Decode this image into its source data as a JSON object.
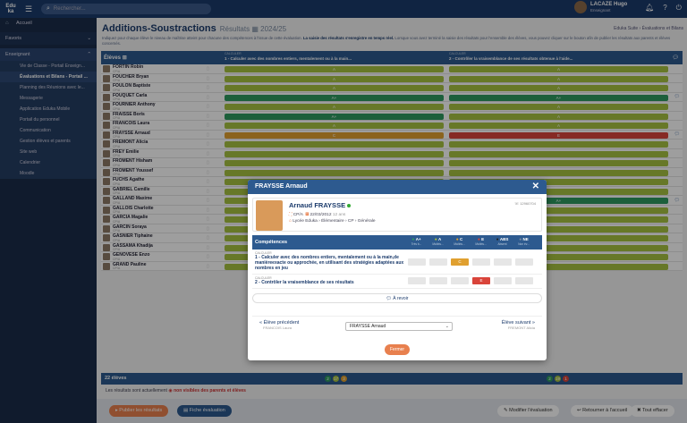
{
  "app": {
    "logo_line1": "Edu",
    "logo_line2": "ka",
    "search_placeholder": "Rechercher..."
  },
  "user": {
    "name": "LACAZE Hugo",
    "role": "Enseignant"
  },
  "sidebar": {
    "top": [
      {
        "label": "Accueil",
        "icon": "home-icon"
      }
    ],
    "favoris": "Favoris",
    "enseignant": "Enseignant",
    "sub": [
      {
        "label": "Vie de Classe - Portail Enseign...",
        "active": false
      },
      {
        "label": "Évaluations et Bilans - Portail ...",
        "active": true
      },
      {
        "label": "Planning des Réunions avec le...",
        "active": false
      },
      {
        "label": "Messagerie",
        "active": false
      },
      {
        "label": "Application Eduka Mobile",
        "active": false
      },
      {
        "label": "Portail du personnel",
        "active": false
      },
      {
        "label": "Communication",
        "active": false
      },
      {
        "label": "Gestion élèves et parents",
        "active": false
      },
      {
        "label": "Site web",
        "active": false
      },
      {
        "label": "Calendrier",
        "active": false
      },
      {
        "label": "Moodle",
        "active": false
      }
    ]
  },
  "page": {
    "title": "Additions-Soustractions",
    "subtitle": "Résultats",
    "year": "2024/25",
    "breadcrumb": "Eduka Suite › Évaluations et Bilans",
    "description_1": "Indiquez pour chaque élève le niveau de maîtrise atteint pour chacune des compétences à l'issue de cette évaluation. ",
    "description_bold": "La saisie des résultats s'enregistre en temps réel.",
    "description_2": " Lorsque vous avez terminé la saisie des résultats pour l'ensemble des élèves, vous pouvez cliquer sur le bouton afin de publier les résultats aux parents et élèves concernés."
  },
  "table": {
    "students_header": "Élèves",
    "c1_label": "CALCULER",
    "c1_text": "1 - Calculer avec des nombres entiers, mentalement ou à la main...",
    "c2_label": "CALCULER",
    "c2_text": "2 - Contrôler la vraisemblance de ses résultats obtenue à l'aide...",
    "rows": [
      {
        "name": "FORTIN Robin",
        "class": "CP/A",
        "r1": "A",
        "r2": "A",
        "c1": "#a7c242",
        "c2": "#a7c242"
      },
      {
        "name": "FOUCHER Bryan",
        "class": "CP/A",
        "r1": "A",
        "r2": "A",
        "c1": "#a7c242",
        "c2": "#a7c242"
      },
      {
        "name": "FOULON Baptiste",
        "class": "CP/A",
        "r1": "A",
        "r2": "A",
        "c1": "#a7c242",
        "c2": "#a7c242"
      },
      {
        "name": "FOUQUET Carla",
        "class": "CP/A",
        "r1": "A+",
        "r2": "A+",
        "c1": "#2e9a60",
        "c2": "#2e9a60"
      },
      {
        "name": "FOURNIER Anthony",
        "class": "CP/A",
        "r1": "A",
        "r2": "A",
        "c1": "#a7c242",
        "c2": "#a7c242"
      },
      {
        "name": "FRAISSE Boris",
        "class": "CP/A",
        "r1": "A+",
        "r2": "A",
        "c1": "#2e9a60",
        "c2": "#a7c242"
      },
      {
        "name": "FRANCOIS Laura",
        "class": "CP/A",
        "r1": "A",
        "r2": "A",
        "c1": "#a7c242",
        "c2": "#a7c242"
      },
      {
        "name": "FRAYSSE Arnaud",
        "class": "CP/A",
        "r1": "C",
        "r2": "E",
        "c1": "#e0a030",
        "c2": "#d9443a"
      },
      {
        "name": "FREMONT Alicia",
        "class": "CP/A",
        "r1": "",
        "r2": "",
        "c1": "#a7c242",
        "c2": "#a7c242"
      },
      {
        "name": "FREY Emilie",
        "class": "CP/A",
        "r1": "",
        "r2": "",
        "c1": "#a7c242",
        "c2": "#a7c242"
      },
      {
        "name": "FROMENT Hisham",
        "class": "CP/A",
        "r1": "",
        "r2": "",
        "c1": "#a7c242",
        "c2": "#a7c242"
      },
      {
        "name": "FROMENT Youssef",
        "class": "CP/A",
        "r1": "",
        "r2": "",
        "c1": "#a7c242",
        "c2": "#a7c242"
      },
      {
        "name": "FUCHS Agathe",
        "class": "CP/A",
        "r1": "",
        "r2": "",
        "c1": "#a7c242",
        "c2": "#a7c242"
      },
      {
        "name": "GABRIEL Camille",
        "class": "CP/A",
        "r1": "",
        "r2": "",
        "c1": "#a7c242",
        "c2": "#a7c242"
      },
      {
        "name": "GALLAND Maxime",
        "class": "CP/A",
        "r1": "",
        "r2": "A+",
        "c1": "#a7c242",
        "c2": "#2e9a60"
      },
      {
        "name": "GALLOIS Charlotte",
        "class": "CP/A",
        "r1": "",
        "r2": "",
        "c1": "#a7c242",
        "c2": "#a7c242"
      },
      {
        "name": "GARCIA Magalie",
        "class": "CP/A",
        "r1": "",
        "r2": "",
        "c1": "#a7c242",
        "c2": "#a7c242"
      },
      {
        "name": "GARCIN Soraya",
        "class": "CP/A",
        "r1": "",
        "r2": "",
        "c1": "#a7c242",
        "c2": "#a7c242"
      },
      {
        "name": "GASNIER Tiphaine",
        "class": "CP/A",
        "r1": "",
        "r2": "",
        "c1": "#a7c242",
        "c2": "#a7c242"
      },
      {
        "name": "GASSAMA Khadija",
        "class": "CP/A",
        "r1": "",
        "r2": "",
        "c1": "#a7c242",
        "c2": "#a7c242"
      },
      {
        "name": "GENOVESE Enzo",
        "class": "CP/A",
        "r1": "",
        "r2": "",
        "c1": "#a7c242",
        "c2": "#a7c242"
      },
      {
        "name": "GRAND Pauline",
        "class": "CP/A",
        "r1": "",
        "r2": "",
        "c1": "#a7c242",
        "c2": "#a7c242"
      }
    ],
    "footer_count": "22 élèves",
    "footer_pills_1": [
      {
        "v": "2",
        "color": "#2e9a60"
      },
      {
        "v": "17",
        "color": "#a7c242"
      },
      {
        "v": "3",
        "color": "#e0a030"
      }
    ],
    "footer_pills_2": [
      {
        "v": "2",
        "color": "#2e9a60"
      },
      {
        "v": "19",
        "color": "#a7c242"
      },
      {
        "v": "1",
        "color": "#d9443a"
      }
    ]
  },
  "note": {
    "prefix": "Les résultats sont actuellement",
    "red": "non visibles des parents et élèves"
  },
  "buttons": {
    "publish": "Publier les résultats",
    "fiche": "Fiche évaluation",
    "modifier": "Modifier l'évaluation",
    "retour": "Retourner à l'accueil",
    "effacer": "Tout effacer"
  },
  "modal": {
    "title": "FRAYSSE Arnaud",
    "student_name": "Arnaud FRAYSSE",
    "student_id": "12960704",
    "class": "CP/A",
    "dob": "22/03/2012",
    "age": "12 ans",
    "school": "Lycée Eduka › Élémentaire › CP › Générale",
    "comp_header": "Compétences",
    "levels": [
      {
        "code": "A+",
        "label": "Très b...",
        "color": "#2e9a60"
      },
      {
        "code": "A",
        "label": "Maîtris...",
        "color": "#a7c242"
      },
      {
        "code": "C",
        "label": "Maîtris...",
        "color": "#e0a030"
      },
      {
        "code": "E",
        "label": "Maîtris...",
        "color": "#d9443a"
      },
      {
        "code": "ABS",
        "label": "Absent",
        "color": "#222222"
      },
      {
        "code": "NE",
        "label": "Non év...",
        "color": "#7a8aa0"
      }
    ],
    "competences": [
      {
        "label": "CALCULER",
        "text": "1 - Calculer avec des nombres entiers, mentalement ou à la main,de manièreexacte ou approchée, en utilisant des stratégies adaptées aux nombres en jeu",
        "selected": "C",
        "sel_index": 2,
        "sel_color": "#e0a030"
      },
      {
        "label": "CALCULER",
        "text": "2 - Contrôler la vraisemblance de ses résultats",
        "selected": "E",
        "sel_index": 3,
        "sel_color": "#d9443a"
      }
    ],
    "revoir": "À revoir",
    "prev_label": "« Élève précédent",
    "prev_name": "FRANCOIS Laura",
    "next_label": "Élève suivant »",
    "next_name": "FREMONT Alicia",
    "select_value": "FRAYSSE Arnaud",
    "close": "Fermer"
  }
}
